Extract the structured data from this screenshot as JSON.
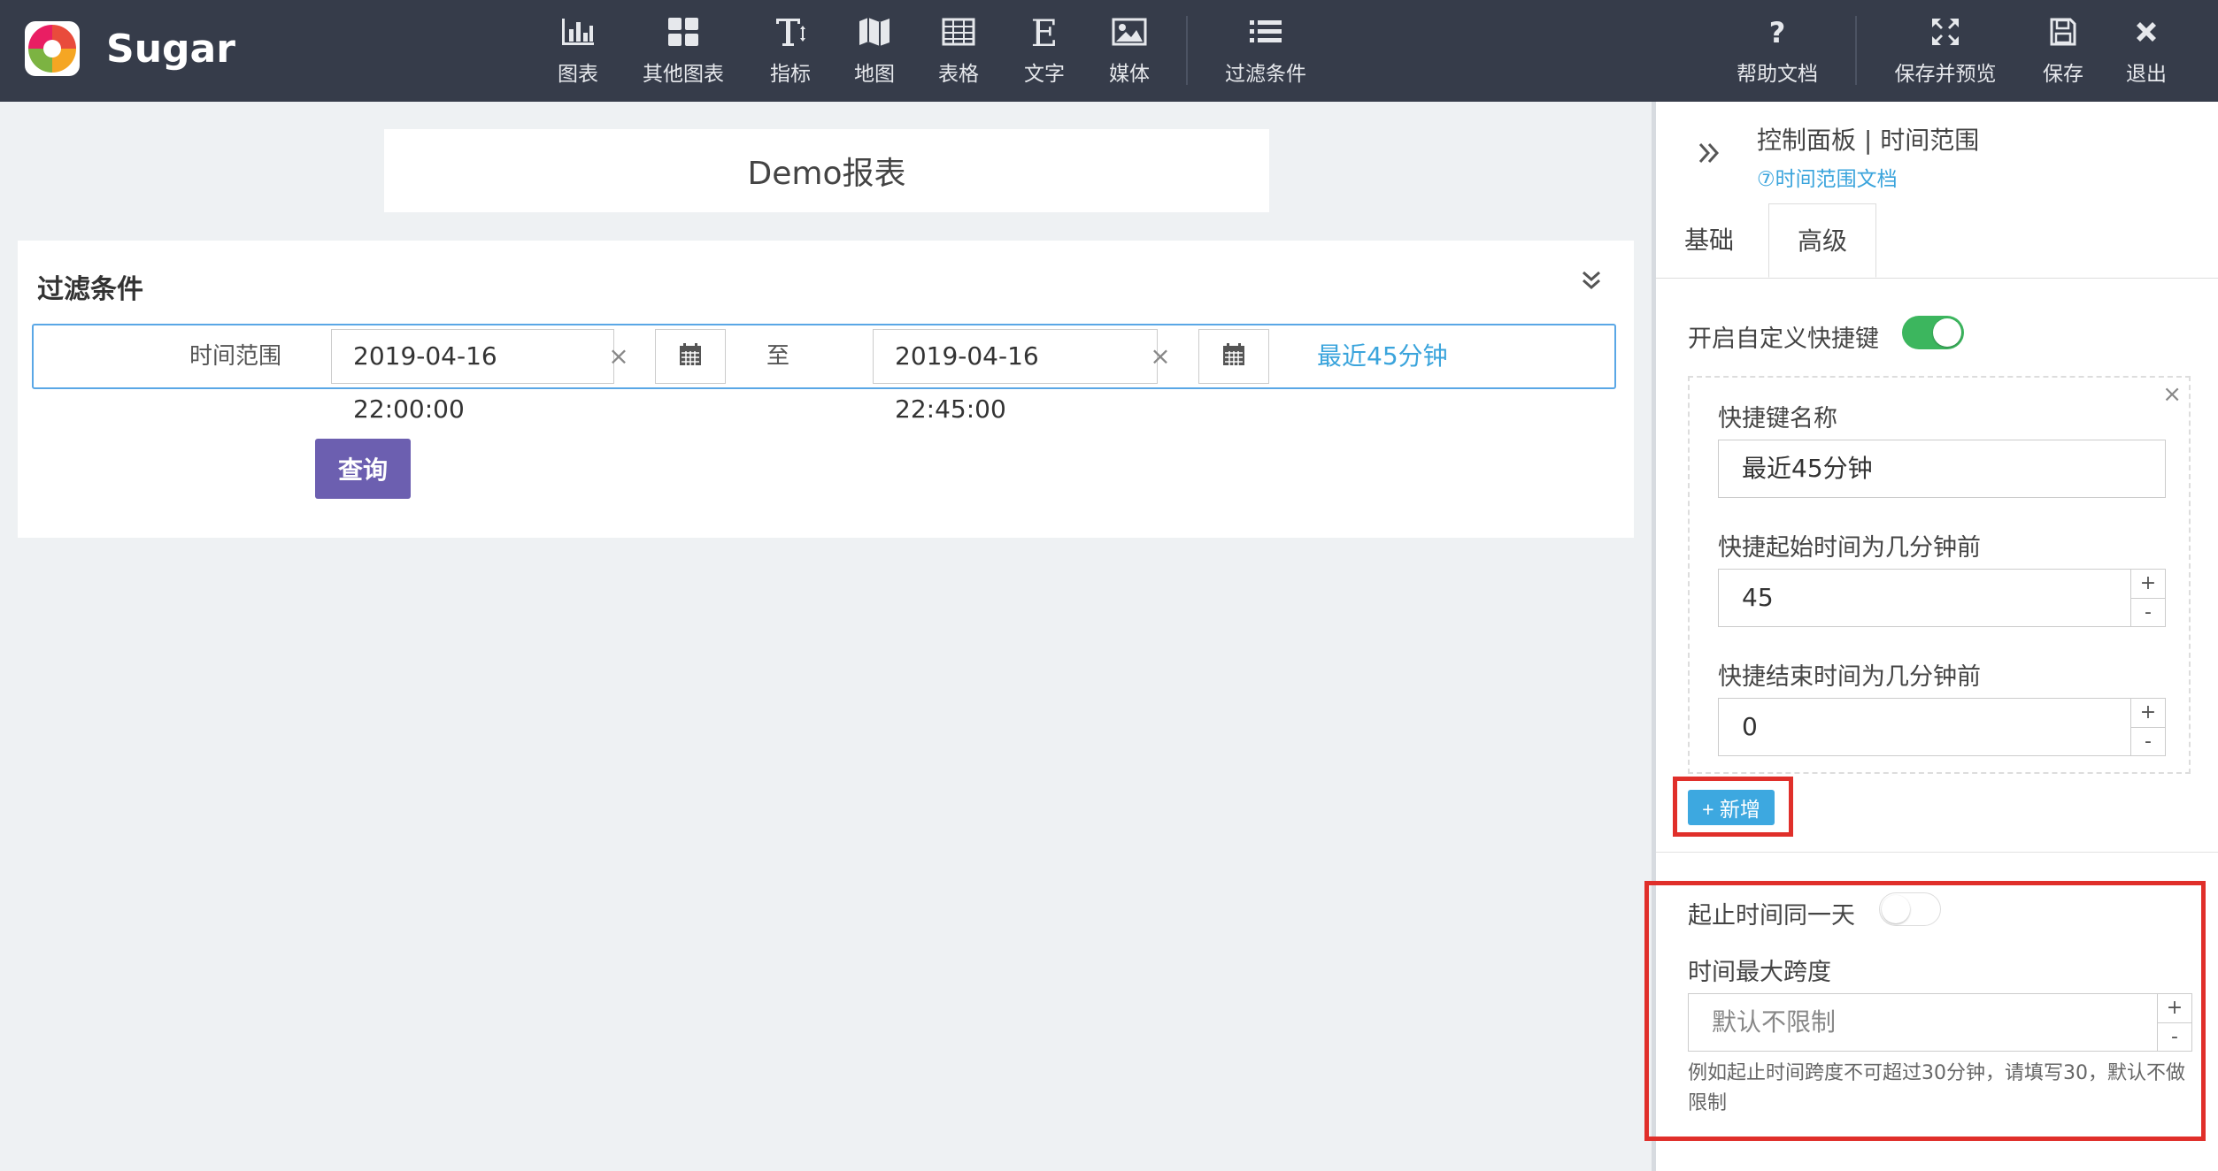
{
  "app": {
    "name": "Sugar"
  },
  "toolbar": {
    "items": [
      {
        "label": "图表",
        "icon": "bar-chart-icon"
      },
      {
        "label": "其他图表",
        "icon": "grid-icon"
      },
      {
        "label": "指标",
        "icon": "text-height-icon"
      },
      {
        "label": "地图",
        "icon": "map-icon"
      },
      {
        "label": "表格",
        "icon": "table-icon"
      },
      {
        "label": "文字",
        "icon": "text-e-icon"
      },
      {
        "label": "媒体",
        "icon": "image-icon"
      },
      {
        "label": "过滤条件",
        "icon": "list-icon"
      }
    ],
    "right_items": [
      {
        "label": "帮助文档",
        "icon": "question-icon"
      },
      {
        "label": "保存并预览",
        "icon": "expand-icon"
      },
      {
        "label": "保存",
        "icon": "floppy-icon"
      },
      {
        "label": "退出",
        "icon": "close-icon"
      }
    ]
  },
  "report": {
    "title": "Demo报表"
  },
  "filter": {
    "title": "过滤条件",
    "range_label": "时间范围",
    "start_value": "2019-04-16 22:00:00",
    "to_label": "至",
    "end_value": "2019-04-16 22:45:00",
    "clear_glyph": "×",
    "shortcut_link": "最近45分钟",
    "query_button": "查询"
  },
  "panel": {
    "title": "控制面板 | 时间范围",
    "doc_link": "⑦时间范围文档",
    "tabs": [
      "基础",
      "高级"
    ],
    "active_tab": "高级",
    "custom_shortcut_label": "开启自定义快捷键",
    "custom_shortcut_enabled": true,
    "shortcut": {
      "close_glyph": "×",
      "name_label": "快捷键名称",
      "name_value": "最近45分钟",
      "start_label": "快捷起始时间为几分钟前",
      "start_value": "45",
      "end_label": "快捷结束时间为几分钟前",
      "end_value": "0"
    },
    "stepper": {
      "plus": "+",
      "minus": "-"
    },
    "add_button": "+ 新增",
    "same_day_label": "起止时间同一天",
    "same_day_enabled": false,
    "max_span_label": "时间最大跨度",
    "max_span_placeholder": "默认不限制",
    "hint": "例如起止时间跨度不可超过30分钟，请填写30，默认不做限制"
  },
  "colors": {
    "topbar": "#363c4a",
    "accent_blue": "#3da8e0",
    "query_purple": "#6c5fb0",
    "toggle_on": "#3cb65e",
    "highlight_red": "#e02f2a"
  }
}
